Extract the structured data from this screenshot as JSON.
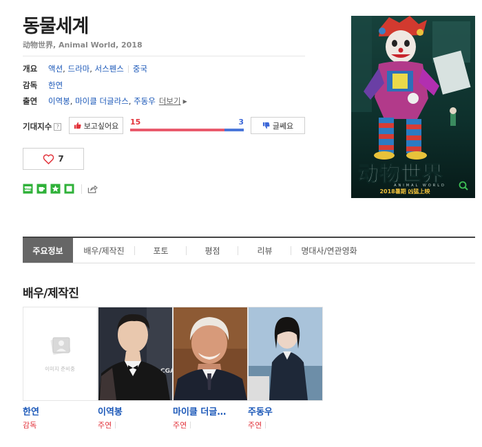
{
  "movie": {
    "title": "동물세계",
    "subtitle": "动物世界, Animal World, 2018"
  },
  "info": {
    "genre_label": "개요",
    "genres": [
      "액션",
      "드라마",
      "서스펜스"
    ],
    "country": "중국",
    "director_label": "감독",
    "director": "한연",
    "cast_label": "출연",
    "cast": [
      "이역봉",
      "마이클 더글라스",
      "주동우"
    ],
    "more_label": "더보기"
  },
  "expectation": {
    "label": "기대지수",
    "help": "?",
    "want_label": "보고싶어요",
    "dislike_label": "글쎄요",
    "want_count": "15",
    "dislike_count": "3",
    "want_fraction": 0.83
  },
  "like": {
    "count": "7"
  },
  "tabs": [
    {
      "label": "주요정보",
      "active": true
    },
    {
      "label": "배우/제작진",
      "active": false
    },
    {
      "label": "포토",
      "active": false
    },
    {
      "label": "평점",
      "active": false
    },
    {
      "label": "리뷰",
      "active": false
    },
    {
      "label": "명대사/연관영화",
      "active": false
    }
  ],
  "section": {
    "title": "배우/제작진"
  },
  "people": [
    {
      "name": "한연",
      "role": "감독",
      "placeholder": "이미지 준비중"
    },
    {
      "name": "이역봉",
      "role": "주연"
    },
    {
      "name": "마이클 더글…",
      "role": "주연"
    },
    {
      "name": "주동우",
      "role": "주연"
    }
  ],
  "poster": {
    "title_art": "动物世界",
    "tagline": "2018暑期 凶猛上映",
    "english": "ANIMAL WORLD"
  },
  "colors": {
    "link": "#1a57b8",
    "accent_red": "#e2333b",
    "accent_blue": "#3d68d8",
    "share_green": "#2fb139"
  }
}
